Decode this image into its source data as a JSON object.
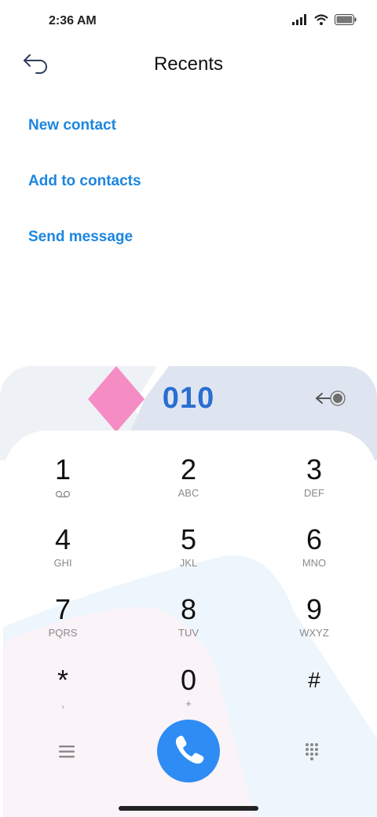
{
  "status_bar": {
    "time": "2:36 AM",
    "icons": [
      "signal-icon",
      "wifi-icon",
      "battery-icon"
    ]
  },
  "header": {
    "title": "Recents",
    "back_icon": "back-arrow-icon"
  },
  "actions": [
    {
      "label": "New contact"
    },
    {
      "label": "Add to contacts"
    },
    {
      "label": "Send message"
    }
  ],
  "dialer": {
    "number": "010",
    "backspace_icon": "backspace-icon",
    "keys": [
      {
        "digit": "1",
        "letters": "",
        "icon": "voicemail-icon"
      },
      {
        "digit": "2",
        "letters": "ABC"
      },
      {
        "digit": "3",
        "letters": "DEF"
      },
      {
        "digit": "4",
        "letters": "GHI"
      },
      {
        "digit": "5",
        "letters": "JKL"
      },
      {
        "digit": "6",
        "letters": "MNO"
      },
      {
        "digit": "7",
        "letters": "PQRS"
      },
      {
        "digit": "8",
        "letters": "TUV"
      },
      {
        "digit": "9",
        "letters": "WXYZ"
      },
      {
        "digit": "*",
        "letters": ","
      },
      {
        "digit": "0",
        "letters": "+"
      },
      {
        "digit": "#",
        "letters": ""
      }
    ],
    "bottom": {
      "menu_icon": "menu-icon",
      "call_icon": "phone-icon",
      "keypad_icon": "keypad-grid-icon"
    }
  },
  "colors": {
    "accent": "#1b86e0",
    "number": "#2a6ed2",
    "call_button": "#2f8cf5",
    "diamond": "#f58cc3",
    "header_band": "#dfe5f0"
  }
}
